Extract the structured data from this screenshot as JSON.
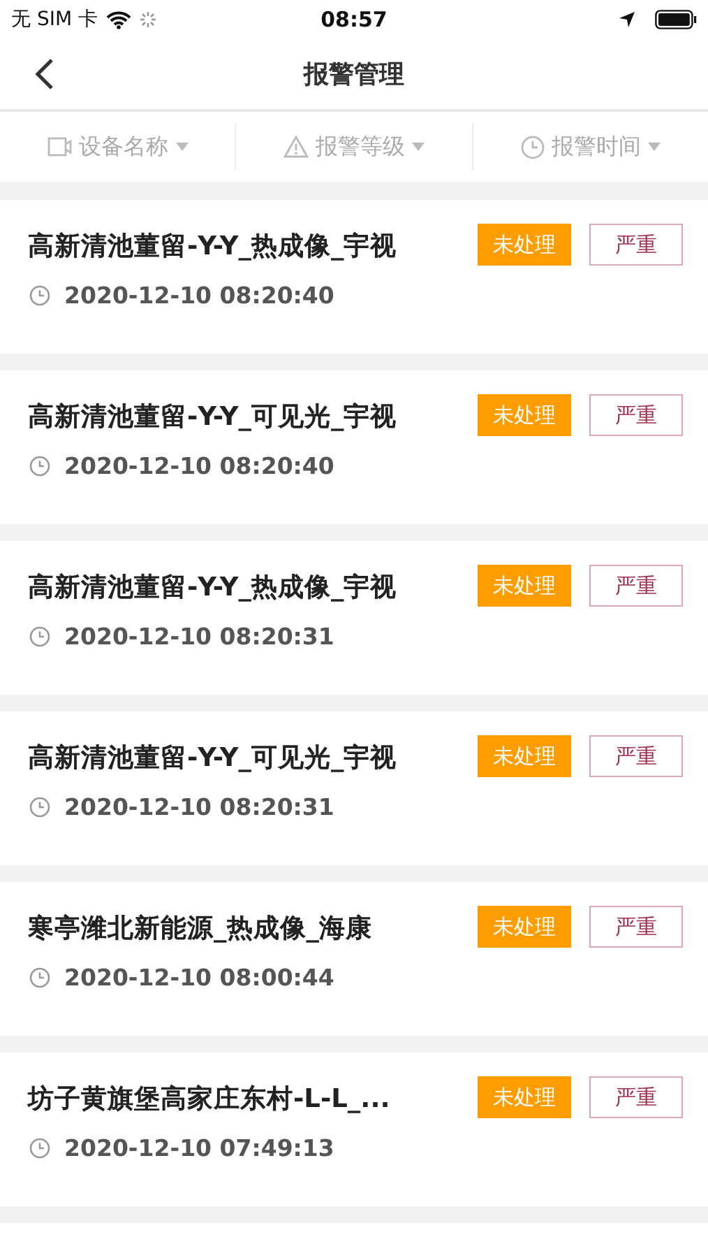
{
  "status_bar": {
    "carrier": "无 SIM 卡",
    "time": "08:57"
  },
  "nav": {
    "title": "报警管理"
  },
  "filters": [
    {
      "kind": "device",
      "label": "设备名称"
    },
    {
      "kind": "level",
      "label": "报警等级"
    },
    {
      "kind": "time",
      "label": "报警时间"
    }
  ],
  "alarms": [
    {
      "title": "高新清池董留-Y-Y_热成像_宇视",
      "time": "2020-12-10 08:20:40",
      "status": "未处理",
      "level": "严重"
    },
    {
      "title": "高新清池董留-Y-Y_可见光_宇视",
      "time": "2020-12-10 08:20:40",
      "status": "未处理",
      "level": "严重"
    },
    {
      "title": "高新清池董留-Y-Y_热成像_宇视",
      "time": "2020-12-10 08:20:31",
      "status": "未处理",
      "level": "严重"
    },
    {
      "title": "高新清池董留-Y-Y_可见光_宇视",
      "time": "2020-12-10 08:20:31",
      "status": "未处理",
      "level": "严重"
    },
    {
      "title": "寒亭潍北新能源_热成像_海康",
      "time": "2020-12-10 08:00:44",
      "status": "未处理",
      "level": "严重"
    },
    {
      "title": "坊子黄旗堡高家庄东村-L-L_...",
      "time": "2020-12-10 07:49:13",
      "status": "未处理",
      "level": "严重"
    }
  ]
}
